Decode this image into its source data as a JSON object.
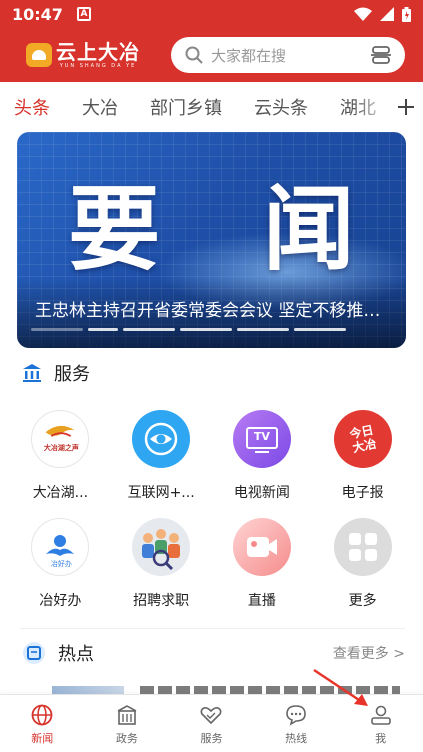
{
  "status_bar": {
    "time": "10:47",
    "notification_icon": "A",
    "icons": [
      "wifi-icon",
      "signal-icon",
      "battery-icon"
    ]
  },
  "header": {
    "logo_text": "云上大冶",
    "logo_pinyin": "YUN SHANG DA YE",
    "search_placeholder": "大家都在搜",
    "brand_color": "#d7322b"
  },
  "channel_tabs": [
    {
      "label": "头条",
      "active": true
    },
    {
      "label": "大冶",
      "active": false
    },
    {
      "label": "部门乡镇",
      "active": false
    },
    {
      "label": "云头条",
      "active": false
    },
    {
      "label": "湖北",
      "active": false
    }
  ],
  "banner": {
    "headline": [
      "要",
      "闻"
    ],
    "caption": "王忠林主持召开省委常委会会议 坚定不移推进高质量发展",
    "slide_count": 6,
    "active_slide": 2
  },
  "services_section": {
    "title": "服务",
    "icon": "bank-icon"
  },
  "services": [
    {
      "label": "大冶湖...",
      "icon": "radio-logo-icon",
      "icon_text": "大冶湖之声"
    },
    {
      "label": "互联网+...",
      "icon": "eye-icon"
    },
    {
      "label": "电视新闻",
      "icon": "tv-icon",
      "icon_text": "TV"
    },
    {
      "label": "电子报",
      "icon": "newspaper-icon",
      "icon_text": "今日大冶"
    },
    {
      "label": "冶好办",
      "icon": "hands-icon",
      "icon_text": "冶好办"
    },
    {
      "label": "招聘求职",
      "icon": "people-search-icon"
    },
    {
      "label": "直播",
      "icon": "video-camera-icon"
    },
    {
      "label": "更多",
      "icon": "grid-icon"
    }
  ],
  "hot_section": {
    "title": "热点",
    "icon": "calendar-icon",
    "more_label": "查看更多 >"
  },
  "bottom_nav": [
    {
      "label": "新闻",
      "icon": "globe-icon",
      "active": true
    },
    {
      "label": "政务",
      "icon": "building-icon",
      "active": false
    },
    {
      "label": "服务",
      "icon": "handshake-icon",
      "active": false
    },
    {
      "label": "热线",
      "icon": "chat-icon",
      "active": false
    },
    {
      "label": "我",
      "icon": "person-icon",
      "active": false
    }
  ]
}
